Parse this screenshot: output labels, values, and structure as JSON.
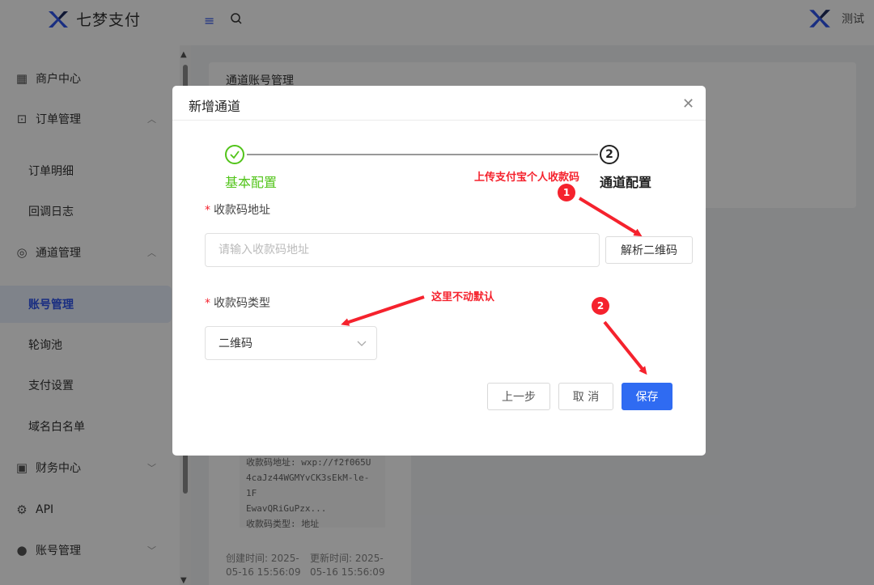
{
  "header": {
    "app_name": "七梦支付",
    "user_name": "测试"
  },
  "sidebar": {
    "items": [
      {
        "label": "商户中心",
        "icon": "grid-icon"
      },
      {
        "label": "订单管理",
        "icon": "bag-icon"
      },
      {
        "label": "订单明细"
      },
      {
        "label": "回调日志"
      },
      {
        "label": "通道管理",
        "icon": "globe-icon"
      },
      {
        "label": "账号管理"
      },
      {
        "label": "轮询池"
      },
      {
        "label": "支付设置"
      },
      {
        "label": "域名白名单"
      },
      {
        "label": "财务中心",
        "icon": "wallet-icon"
      },
      {
        "label": "API",
        "icon": "gear-icon"
      },
      {
        "label": "账号管理",
        "icon": "user-icon"
      }
    ]
  },
  "background": {
    "card_title": "通道账号管理",
    "code_lines": [
      "收款码地址: wxp://f2f065U",
      "4caJz44WGMYvCK3sEkM-le-1F",
      "EwavQRiGuPzx...",
      "收款码类型: 地址"
    ],
    "created": "创建时间: 2025-05-16 15:56:09",
    "updated": "更新时间: 2025-05-16 15:56:09"
  },
  "modal": {
    "title": "新增通道",
    "steps": [
      {
        "label": "基本配置",
        "status": "done"
      },
      {
        "label": "通道配置",
        "number": "2",
        "status": "current"
      }
    ],
    "qr_address": {
      "label": "收款码地址",
      "placeholder": "请输入收款码地址",
      "value": "",
      "parse_button": "解析二维码"
    },
    "qr_type": {
      "label": "收款码类型",
      "value": "二维码"
    },
    "buttons": {
      "prev": "上一步",
      "cancel": "取 消",
      "save": "保存"
    }
  },
  "annotations": {
    "upload_note": "上传支付宝个人收款码",
    "default_note": "这里不动默认",
    "badge1": "1",
    "badge2": "2"
  },
  "colors": {
    "primary": "#2f6bf2",
    "success": "#52c41a",
    "annotation": "#f5222d"
  }
}
